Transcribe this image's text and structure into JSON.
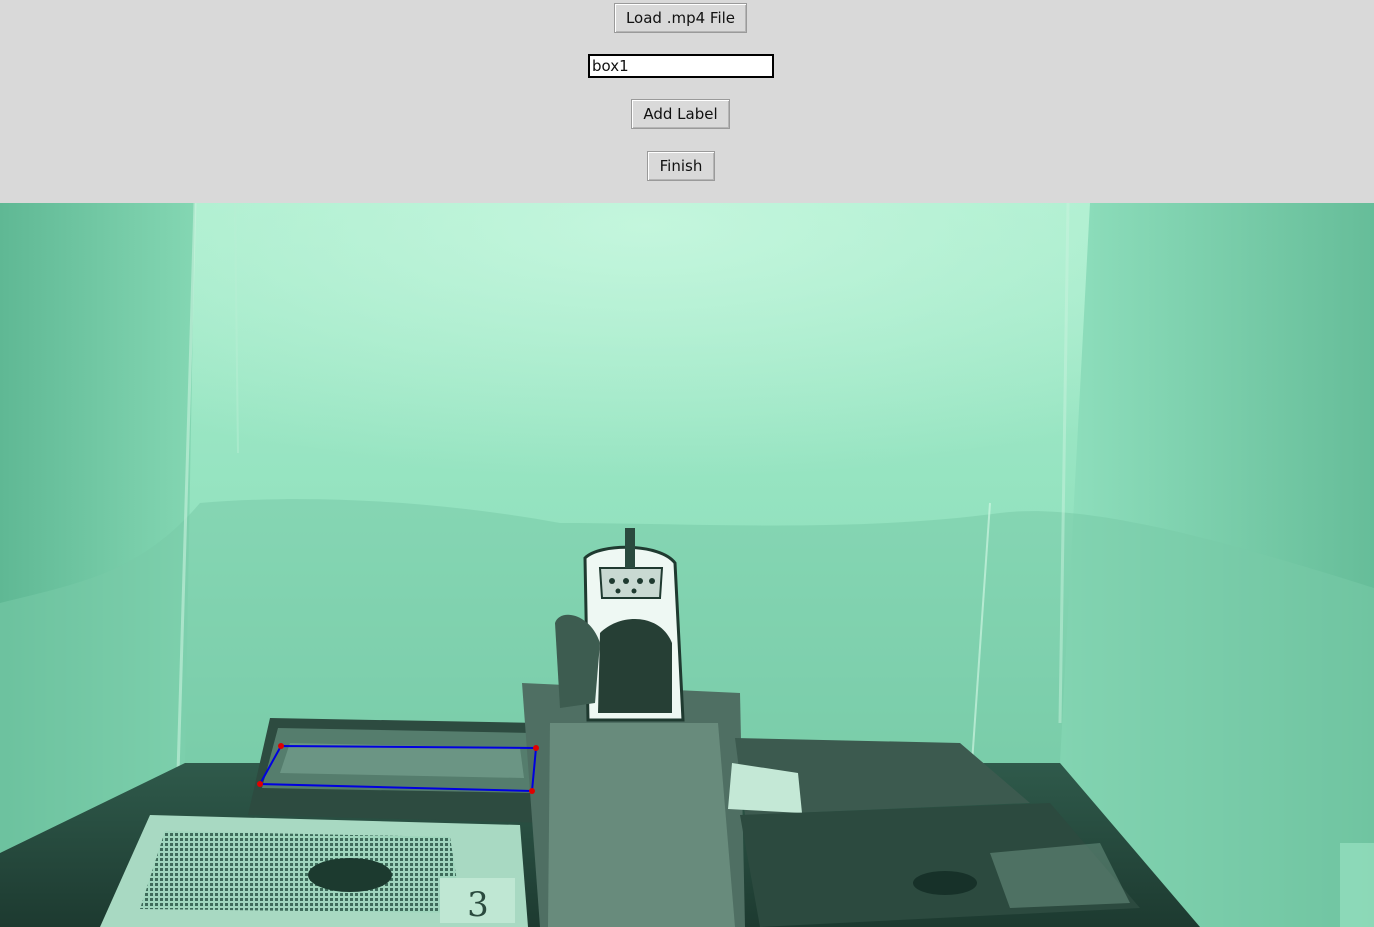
{
  "controls": {
    "load_button_label": "Load .mp4 File",
    "label_input_value": "box1",
    "add_label_button_label": "Add Label",
    "finish_button_label": "Finish"
  },
  "video": {
    "box_number_label": "3",
    "annotation_color": "#0000e0",
    "vertex_color": "#e00000"
  },
  "colors": {
    "panel_bg": "#d9d9d9",
    "night_vision_tint": "#8fe3c0"
  }
}
